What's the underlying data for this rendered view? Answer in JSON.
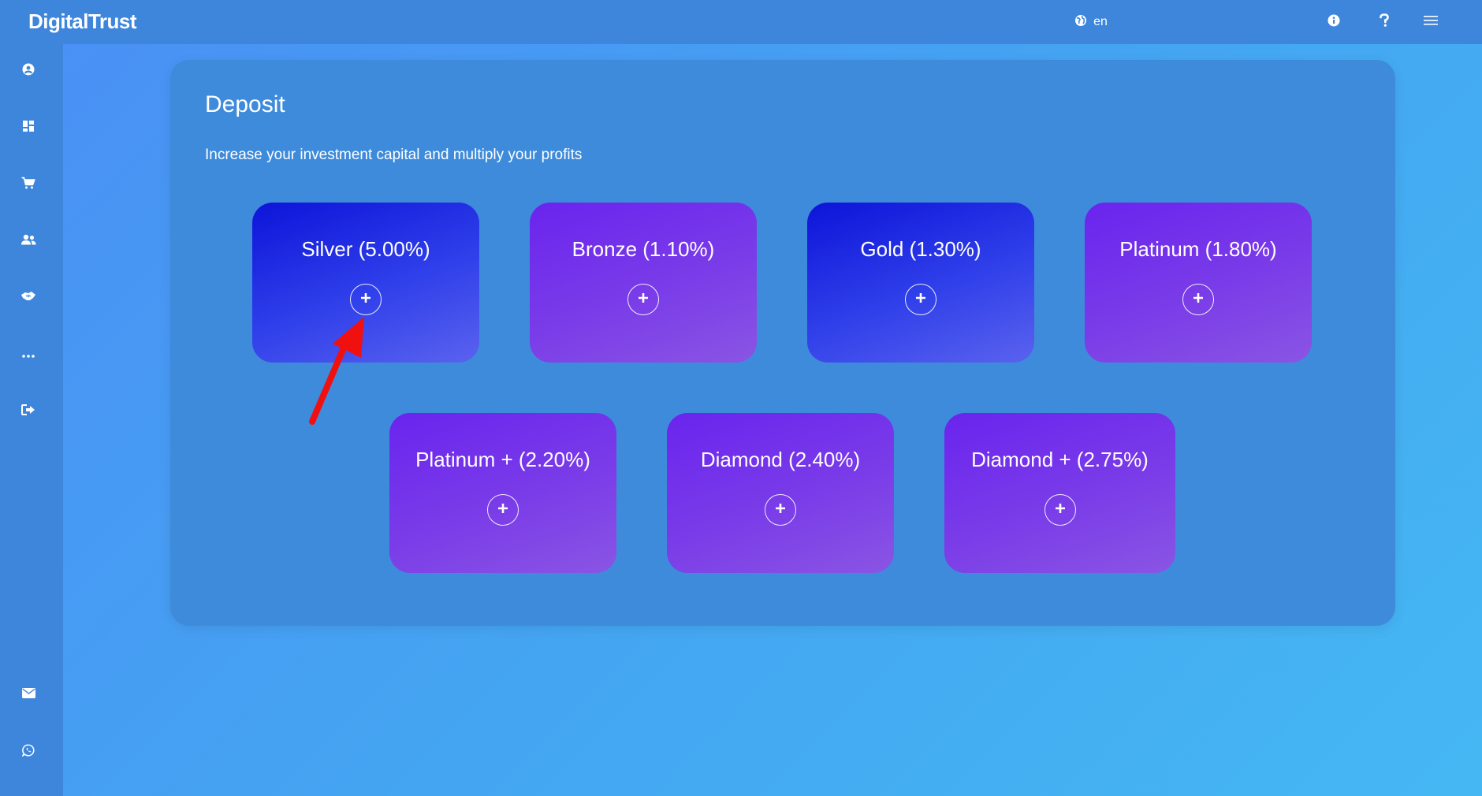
{
  "app": {
    "brand": "DigitalTrust"
  },
  "topbar": {
    "language_label": "en",
    "icons": [
      "globe-icon",
      "info-icon",
      "help-icon",
      "menu-icon"
    ]
  },
  "sidebar": {
    "items": [
      {
        "name": "profile",
        "icon": "user-circle-icon"
      },
      {
        "name": "dashboard",
        "icon": "dashboard-icon"
      },
      {
        "name": "shop",
        "icon": "cart-icon"
      },
      {
        "name": "team",
        "icon": "users-icon"
      },
      {
        "name": "handshake",
        "icon": "handshake-icon"
      },
      {
        "name": "more",
        "icon": "ellipsis-icon"
      },
      {
        "name": "logout",
        "icon": "logout-icon"
      },
      {
        "name": "mail",
        "icon": "mail-icon"
      },
      {
        "name": "whatsapp",
        "icon": "whatsapp-icon"
      }
    ]
  },
  "deposit": {
    "title": "Deposit",
    "subtitle": "Increase your investment capital and multiply your profits",
    "plans": [
      {
        "label": "Silver (5.00%)",
        "style": "blue"
      },
      {
        "label": "Bronze (1.10%)",
        "style": "violet"
      },
      {
        "label": "Gold (1.30%)",
        "style": "blue"
      },
      {
        "label": "Platinum (1.80%)",
        "style": "violet"
      },
      {
        "label": "Platinum + (2.20%)",
        "style": "violet"
      },
      {
        "label": "Diamond (2.40%)",
        "style": "violet"
      },
      {
        "label": "Diamond + (2.75%)",
        "style": "violet"
      }
    ]
  },
  "colors": {
    "topbar": "#3d86dc",
    "panel": "#3e8bdb",
    "card_blue": "#1a22de",
    "card_violet": "#7030ec",
    "annotation_arrow": "#f01010"
  }
}
